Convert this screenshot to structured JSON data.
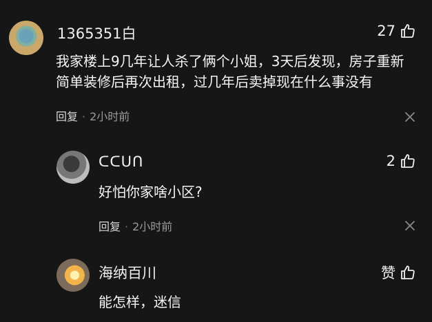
{
  "comments": [
    {
      "username": "1365351白",
      "likes": "27",
      "content": "我家楼上9几年让人杀了俩个小姐，3天后发现，房子重新简单装修后再次出租，过几年后卖掉现在什么事没有",
      "reply_label": "回复",
      "time": "2小时前"
    },
    {
      "username": "ᑕᑕᑌᑎ",
      "likes": "2",
      "content": "好怕你家啥小区?",
      "reply_label": "回复",
      "time": "2小时前"
    },
    {
      "username": "海纳百川",
      "likes": "赞",
      "content": "能怎样，迷信"
    }
  ],
  "meta_separator": "·",
  "icons": {
    "like": "thumbs-up-icon",
    "close": "close-icon"
  },
  "colors": {
    "background": "#161616",
    "text": "#f5f5f5",
    "muted": "#9b9b9b"
  }
}
